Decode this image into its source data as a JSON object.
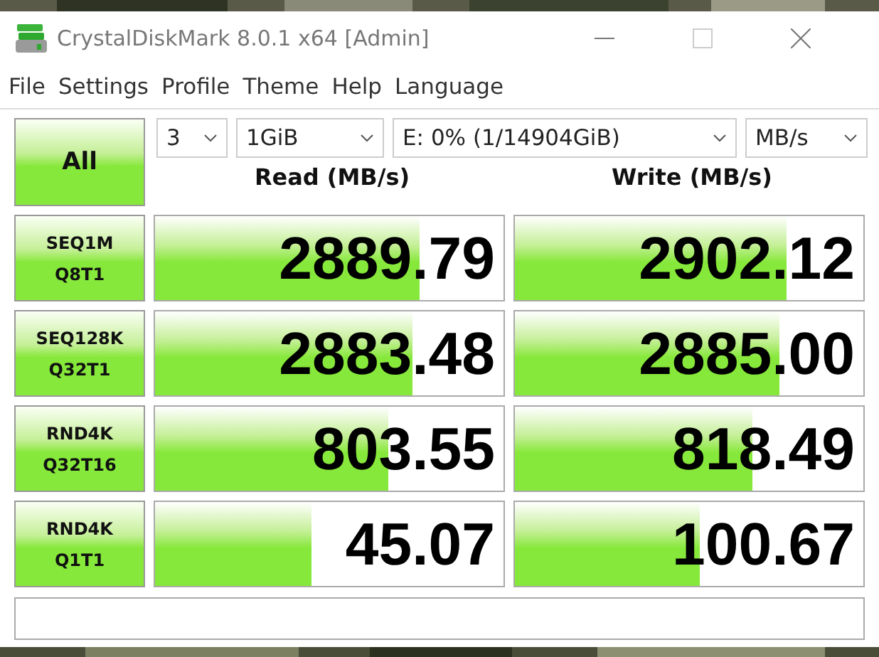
{
  "window": {
    "title": "CrystalDiskMark 8.0.1 x64 [Admin]"
  },
  "menu": [
    "File",
    "Settings",
    "Profile",
    "Theme",
    "Help",
    "Language"
  ],
  "all_button": "All",
  "selectors": [
    {
      "value": "3"
    },
    {
      "value": "1GiB"
    },
    {
      "value": "E: 0% (1/14904GiB)"
    },
    {
      "value": "MB/s"
    }
  ],
  "columns": [
    "Read (MB/s)",
    "Write (MB/s)"
  ],
  "rows": [
    {
      "test": "SEQ1M",
      "params": "Q8T1",
      "read": {
        "value": "2889.79",
        "level": 0.76
      },
      "write": {
        "value": "2902.12",
        "level": 0.78
      }
    },
    {
      "test": "SEQ128K",
      "params": "Q32T1",
      "read": {
        "value": "2883.48",
        "level": 0.74
      },
      "write": {
        "value": "2885.00",
        "level": 0.76
      }
    },
    {
      "test": "RND4K",
      "params": "Q32T16",
      "read": {
        "value": "803.55",
        "level": 0.67
      },
      "write": {
        "value": "818.49",
        "level": 0.68
      }
    },
    {
      "test": "RND4K",
      "params": "Q1T1",
      "read": {
        "value": "45.07",
        "level": 0.45
      },
      "write": {
        "value": "100.67",
        "level": 0.53
      }
    }
  ]
}
